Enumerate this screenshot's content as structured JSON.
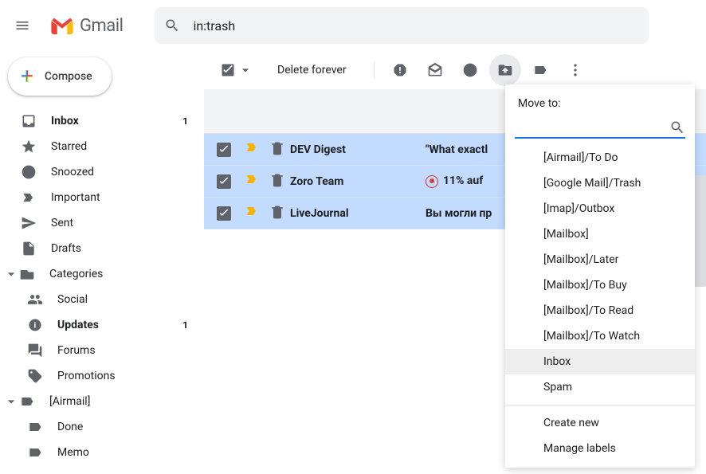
{
  "header": {
    "logo_text": "Gmail",
    "search_value": "in:trash"
  },
  "compose_label": "Compose",
  "sidebar": {
    "items": [
      {
        "label": "Inbox",
        "count": "1",
        "bold": true
      },
      {
        "label": "Starred"
      },
      {
        "label": "Snoozed"
      },
      {
        "label": "Important"
      },
      {
        "label": "Sent"
      },
      {
        "label": "Drafts"
      }
    ],
    "categories_label": "Categories",
    "categories": [
      {
        "label": "Social"
      },
      {
        "label": "Updates",
        "count": "1",
        "bold": true
      },
      {
        "label": "Forums"
      },
      {
        "label": "Promotions"
      }
    ],
    "airmail_label": "[Airmail]",
    "airmail": [
      {
        "label": "Done"
      },
      {
        "label": "Memo"
      }
    ]
  },
  "toolbar": {
    "delete_forever": "Delete forever"
  },
  "rows": [
    {
      "sender": "DEV Digest",
      "subject": "\"What exactl",
      "badge": false
    },
    {
      "sender": "Zoro Team",
      "subject": "11% auf ",
      "badge": true
    },
    {
      "sender": "LiveJournal",
      "subject": "Вы могли пр",
      "badge": false
    }
  ],
  "popup": {
    "title": "Move to:",
    "options": [
      "[Airmail]/To Do",
      "[Google Mail]/Trash",
      "[Imap]/Outbox",
      "[Mailbox]",
      "[Mailbox]/Later",
      "[Mailbox]/To Buy",
      "[Mailbox]/To Read",
      "[Mailbox]/To Watch",
      "Inbox",
      "Spam"
    ],
    "highlighted_index": 8,
    "create_new": "Create new",
    "manage_labels": "Manage labels"
  }
}
